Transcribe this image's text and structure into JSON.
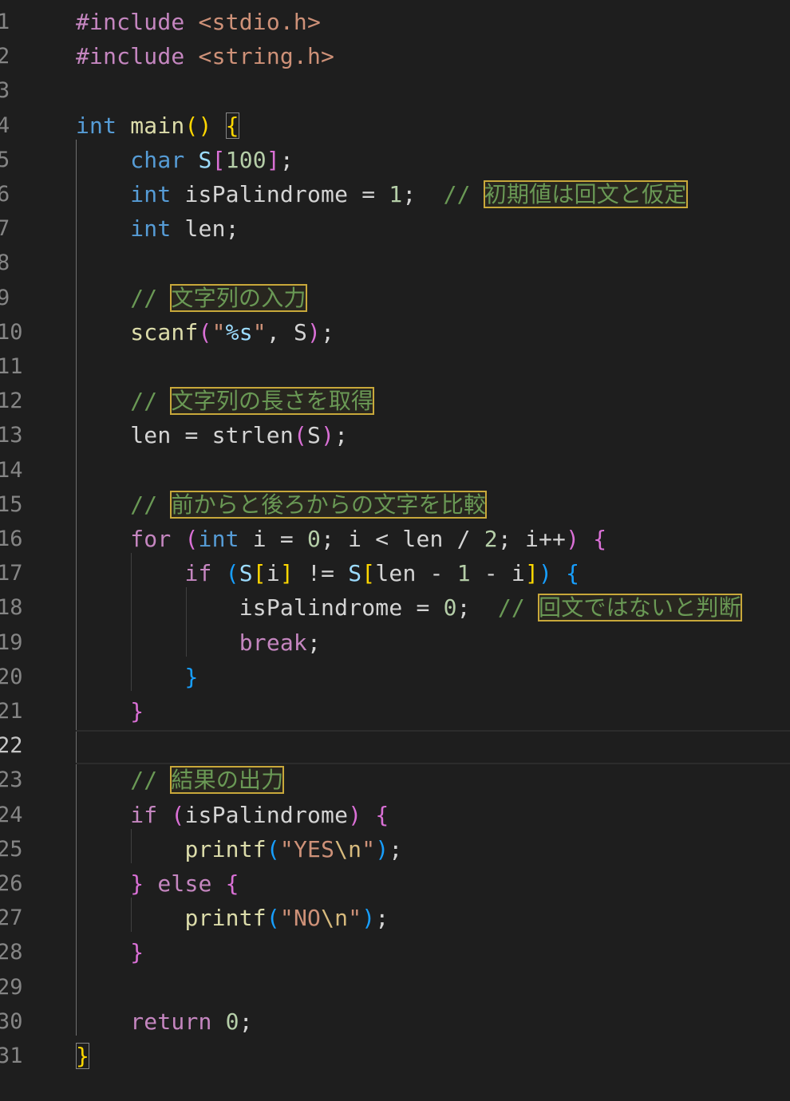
{
  "editor": {
    "current_line": 22,
    "lines": [
      {
        "n": "1",
        "tokens": [
          {
            "t": "#include ",
            "c": "tok-pre"
          },
          {
            "t": "<stdio.h>",
            "c": "tok-inc"
          }
        ]
      },
      {
        "n": "2",
        "tokens": [
          {
            "t": "#include ",
            "c": "tok-pre"
          },
          {
            "t": "<string.h>",
            "c": "tok-inc"
          }
        ]
      },
      {
        "n": "3",
        "tokens": []
      },
      {
        "n": "4",
        "tokens": [
          {
            "t": "int ",
            "c": "tok-type"
          },
          {
            "t": "main",
            "c": "tok-fn"
          },
          {
            "t": "() ",
            "c": "tok-br1"
          },
          {
            "t": "{",
            "c": "tok-br1",
            "m": true
          }
        ]
      },
      {
        "n": "5",
        "tokens": [
          {
            "t": "    "
          },
          {
            "t": "char ",
            "c": "tok-type"
          },
          {
            "t": "S",
            "c": "tok-var"
          },
          {
            "t": "[",
            "c": "tok-br2"
          },
          {
            "t": "100",
            "c": "tok-num"
          },
          {
            "t": "]",
            "c": "tok-br2"
          },
          {
            "t": ";",
            "c": "tok-plain"
          }
        ]
      },
      {
        "n": "6",
        "tokens": [
          {
            "t": "    "
          },
          {
            "t": "int ",
            "c": "tok-type"
          },
          {
            "t": "isPalindrome = ",
            "c": "tok-plain"
          },
          {
            "t": "1",
            "c": "tok-num"
          },
          {
            "t": ";  ",
            "c": "tok-plain"
          },
          {
            "t": "// ",
            "c": "tok-comment"
          },
          {
            "t": "初期値は回文と仮定",
            "c": "tok-comment",
            "h": true
          }
        ]
      },
      {
        "n": "7",
        "tokens": [
          {
            "t": "    "
          },
          {
            "t": "int ",
            "c": "tok-type"
          },
          {
            "t": "len;",
            "c": "tok-plain"
          }
        ]
      },
      {
        "n": "8",
        "tokens": []
      },
      {
        "n": "9",
        "tokens": [
          {
            "t": "    "
          },
          {
            "t": "// ",
            "c": "tok-comment"
          },
          {
            "t": "文字列の入力",
            "c": "tok-comment",
            "h": true
          }
        ]
      },
      {
        "n": "10",
        "tokens": [
          {
            "t": "    "
          },
          {
            "t": "scanf",
            "c": "tok-fn"
          },
          {
            "t": "(",
            "c": "tok-br2"
          },
          {
            "t": "\"",
            "c": "tok-str"
          },
          {
            "t": "%s",
            "c": "tok-var"
          },
          {
            "t": "\"",
            "c": "tok-str"
          },
          {
            "t": ", ",
            "c": "tok-plain"
          },
          {
            "t": "S",
            "c": "tok-plain"
          },
          {
            "t": ")",
            "c": "tok-br2"
          },
          {
            "t": ";",
            "c": "tok-plain"
          }
        ]
      },
      {
        "n": "11",
        "tokens": []
      },
      {
        "n": "12",
        "tokens": [
          {
            "t": "    "
          },
          {
            "t": "// ",
            "c": "tok-comment"
          },
          {
            "t": "文字列の長さを取得",
            "c": "tok-comment",
            "h": true
          }
        ]
      },
      {
        "n": "13",
        "tokens": [
          {
            "t": "    "
          },
          {
            "t": "len = strlen",
            "c": "tok-plain"
          },
          {
            "t": "(",
            "c": "tok-br2"
          },
          {
            "t": "S",
            "c": "tok-plain"
          },
          {
            "t": ")",
            "c": "tok-br2"
          },
          {
            "t": ";",
            "c": "tok-plain"
          }
        ]
      },
      {
        "n": "14",
        "tokens": []
      },
      {
        "n": "15",
        "tokens": [
          {
            "t": "    "
          },
          {
            "t": "// ",
            "c": "tok-comment"
          },
          {
            "t": "前からと後ろからの文字を比較",
            "c": "tok-comment",
            "h": true
          }
        ]
      },
      {
        "n": "16",
        "tokens": [
          {
            "t": "    "
          },
          {
            "t": "for ",
            "c": "tok-kw"
          },
          {
            "t": "(",
            "c": "tok-br2"
          },
          {
            "t": "int ",
            "c": "tok-type"
          },
          {
            "t": "i = ",
            "c": "tok-plain"
          },
          {
            "t": "0",
            "c": "tok-num"
          },
          {
            "t": "; i < len / ",
            "c": "tok-plain"
          },
          {
            "t": "2",
            "c": "tok-num"
          },
          {
            "t": "; i++",
            "c": "tok-plain"
          },
          {
            "t": ") ",
            "c": "tok-br2"
          },
          {
            "t": "{",
            "c": "tok-br2"
          }
        ]
      },
      {
        "n": "17",
        "tokens": [
          {
            "t": "        "
          },
          {
            "t": "if ",
            "c": "tok-kw"
          },
          {
            "t": "(",
            "c": "tok-br3"
          },
          {
            "t": "S",
            "c": "tok-var"
          },
          {
            "t": "[",
            "c": "tok-br1"
          },
          {
            "t": "i",
            "c": "tok-plain"
          },
          {
            "t": "]",
            "c": "tok-br1"
          },
          {
            "t": " != ",
            "c": "tok-plain"
          },
          {
            "t": "S",
            "c": "tok-var"
          },
          {
            "t": "[",
            "c": "tok-br1"
          },
          {
            "t": "len - ",
            "c": "tok-plain"
          },
          {
            "t": "1",
            "c": "tok-num"
          },
          {
            "t": " - i",
            "c": "tok-plain"
          },
          {
            "t": "]",
            "c": "tok-br1"
          },
          {
            "t": ") ",
            "c": "tok-br3"
          },
          {
            "t": "{",
            "c": "tok-br3"
          }
        ]
      },
      {
        "n": "18",
        "tokens": [
          {
            "t": "            "
          },
          {
            "t": "isPalindrome = ",
            "c": "tok-plain"
          },
          {
            "t": "0",
            "c": "tok-num"
          },
          {
            "t": ";  ",
            "c": "tok-plain"
          },
          {
            "t": "// ",
            "c": "tok-comment"
          },
          {
            "t": "回文ではないと判断",
            "c": "tok-comment",
            "h": true
          }
        ]
      },
      {
        "n": "19",
        "tokens": [
          {
            "t": "            "
          },
          {
            "t": "break",
            "c": "tok-kw"
          },
          {
            "t": ";",
            "c": "tok-plain"
          }
        ]
      },
      {
        "n": "20",
        "tokens": [
          {
            "t": "        "
          },
          {
            "t": "}",
            "c": "tok-br3"
          }
        ]
      },
      {
        "n": "21",
        "tokens": [
          {
            "t": "    "
          },
          {
            "t": "}",
            "c": "tok-br2"
          }
        ]
      },
      {
        "n": "22",
        "tokens": []
      },
      {
        "n": "23",
        "tokens": [
          {
            "t": "    "
          },
          {
            "t": "// ",
            "c": "tok-comment"
          },
          {
            "t": "結果の出力",
            "c": "tok-comment",
            "h": true
          }
        ]
      },
      {
        "n": "24",
        "tokens": [
          {
            "t": "    "
          },
          {
            "t": "if ",
            "c": "tok-kw"
          },
          {
            "t": "(",
            "c": "tok-br2"
          },
          {
            "t": "isPalindrome",
            "c": "tok-plain"
          },
          {
            "t": ") ",
            "c": "tok-br2"
          },
          {
            "t": "{",
            "c": "tok-br2"
          }
        ]
      },
      {
        "n": "25",
        "tokens": [
          {
            "t": "        "
          },
          {
            "t": "printf",
            "c": "tok-fn"
          },
          {
            "t": "(",
            "c": "tok-br3"
          },
          {
            "t": "\"YES",
            "c": "tok-str"
          },
          {
            "t": "\\n",
            "c": "tok-esc"
          },
          {
            "t": "\"",
            "c": "tok-str"
          },
          {
            "t": ")",
            "c": "tok-br3"
          },
          {
            "t": ";",
            "c": "tok-plain"
          }
        ]
      },
      {
        "n": "26",
        "tokens": [
          {
            "t": "    "
          },
          {
            "t": "} ",
            "c": "tok-br2"
          },
          {
            "t": "else ",
            "c": "tok-kw"
          },
          {
            "t": "{",
            "c": "tok-br2"
          }
        ]
      },
      {
        "n": "27",
        "tokens": [
          {
            "t": "        "
          },
          {
            "t": "printf",
            "c": "tok-fn"
          },
          {
            "t": "(",
            "c": "tok-br3"
          },
          {
            "t": "\"NO",
            "c": "tok-str"
          },
          {
            "t": "\\n",
            "c": "tok-esc"
          },
          {
            "t": "\"",
            "c": "tok-str"
          },
          {
            "t": ")",
            "c": "tok-br3"
          },
          {
            "t": ";",
            "c": "tok-plain"
          }
        ]
      },
      {
        "n": "28",
        "tokens": [
          {
            "t": "    "
          },
          {
            "t": "}",
            "c": "tok-br2"
          }
        ]
      },
      {
        "n": "29",
        "tokens": []
      },
      {
        "n": "30",
        "tokens": [
          {
            "t": "    "
          },
          {
            "t": "return ",
            "c": "tok-kw"
          },
          {
            "t": "0",
            "c": "tok-num"
          },
          {
            "t": ";",
            "c": "tok-plain"
          }
        ]
      },
      {
        "n": "31",
        "tokens": [
          {
            "t": "}",
            "c": "tok-br1",
            "m": true
          }
        ]
      }
    ]
  }
}
